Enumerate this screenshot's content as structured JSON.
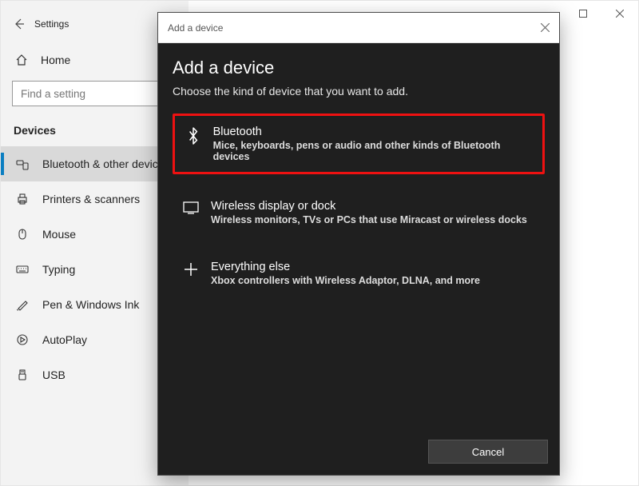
{
  "window": {
    "title": "Settings"
  },
  "sidebar": {
    "home_label": "Home",
    "search_placeholder": "Find a setting",
    "section_title": "Devices",
    "items": [
      {
        "label": "Bluetooth & other devices"
      },
      {
        "label": "Printers & scanners"
      },
      {
        "label": "Mouse"
      },
      {
        "label": "Typing"
      },
      {
        "label": "Pen & Windows Ink"
      },
      {
        "label": "AutoPlay"
      },
      {
        "label": "USB"
      }
    ]
  },
  "modal": {
    "titlebar": "Add a device",
    "heading": "Add a device",
    "subtitle": "Choose the kind of device that you want to add.",
    "options": [
      {
        "title": "Bluetooth",
        "desc": "Mice, keyboards, pens or audio and other kinds of Bluetooth devices"
      },
      {
        "title": "Wireless display or dock",
        "desc": "Wireless monitors, TVs or PCs that use Miracast or wireless docks"
      },
      {
        "title": "Everything else",
        "desc": "Xbox controllers with Wireless Adaptor, DLNA, and more"
      }
    ],
    "cancel_label": "Cancel"
  }
}
